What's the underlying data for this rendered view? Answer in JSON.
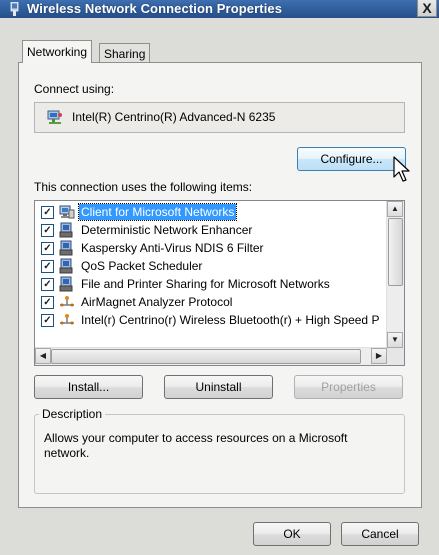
{
  "window": {
    "title": "Wireless Network Connection Properties",
    "close_label": "X"
  },
  "tabs": [
    {
      "label": "Networking",
      "active": true
    },
    {
      "label": "Sharing",
      "active": false
    }
  ],
  "connect_using": {
    "label": "Connect using:",
    "adapter": "Intel(R) Centrino(R) Advanced-N 6235",
    "icon": "network-adapter-icon"
  },
  "buttons": {
    "configure": "Configure...",
    "install": "Install...",
    "uninstall": "Uninstall",
    "properties": "Properties",
    "ok": "OK",
    "cancel": "Cancel"
  },
  "items_label": "This connection uses the following items:",
  "items": [
    {
      "label": "Client for Microsoft Networks",
      "checked": true,
      "selected": true,
      "icon": "client-network-icon"
    },
    {
      "label": "Deterministic Network Enhancer",
      "checked": true,
      "selected": false,
      "icon": "service-icon"
    },
    {
      "label": "Kaspersky Anti-Virus NDIS 6 Filter",
      "checked": true,
      "selected": false,
      "icon": "service-icon"
    },
    {
      "label": "QoS Packet Scheduler",
      "checked": true,
      "selected": false,
      "icon": "service-icon"
    },
    {
      "label": "File and Printer Sharing for Microsoft Networks",
      "checked": true,
      "selected": false,
      "icon": "service-icon"
    },
    {
      "label": "AirMagnet Analyzer Protocol",
      "checked": true,
      "selected": false,
      "icon": "protocol-icon"
    },
    {
      "label": "Intel(r) Centrino(r) Wireless Bluetooth(r) + High Speed P",
      "checked": true,
      "selected": false,
      "icon": "protocol-icon"
    }
  ],
  "description": {
    "legend": "Description",
    "text": "Allows your computer to access resources on a Microsoft network."
  },
  "colors": {
    "titlebar": "#2f5d9c",
    "selection": "#3399ff",
    "panel": "#f4f4f3"
  }
}
